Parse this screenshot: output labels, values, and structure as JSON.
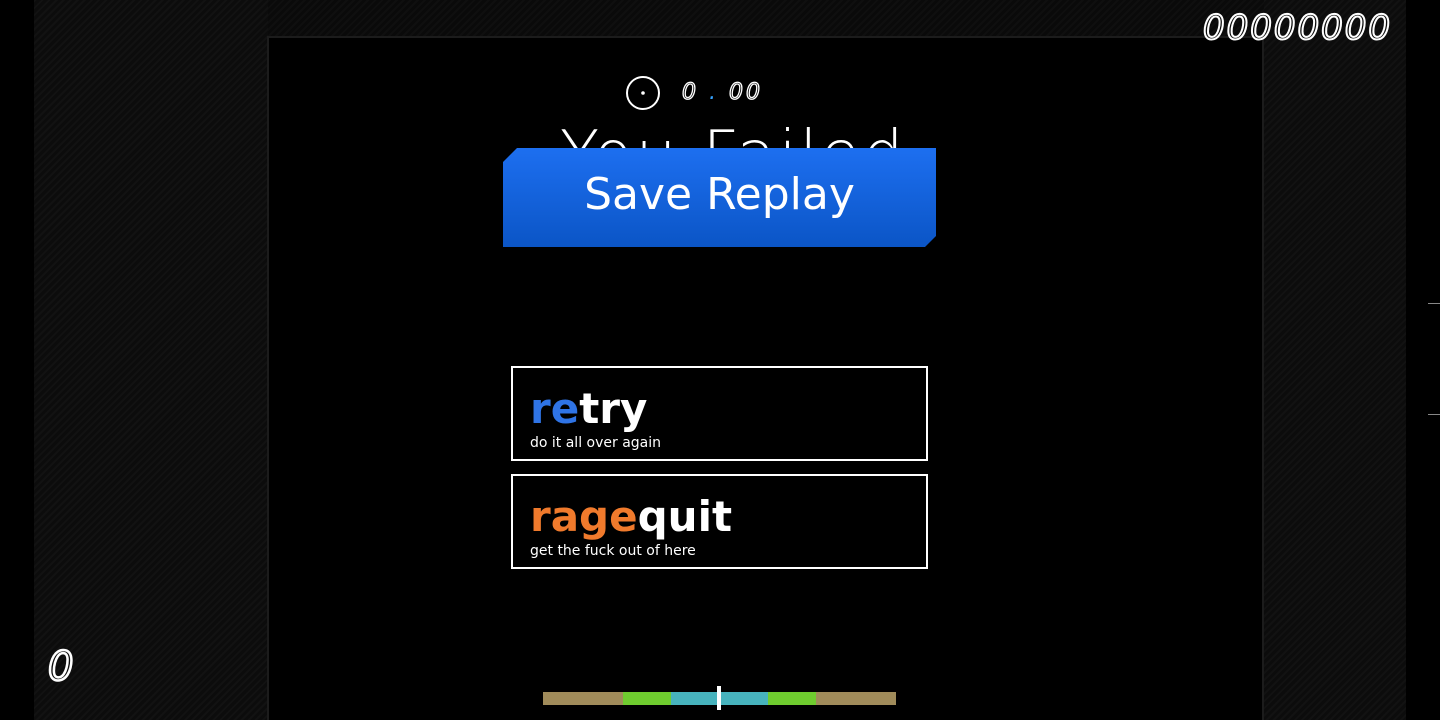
{
  "hud": {
    "score": "00000000",
    "combo": "0",
    "timer_int": "0",
    "timer_sep": ".",
    "timer_frac": "00"
  },
  "failed_title": "You Failed",
  "save_replay": {
    "label": "Save Replay"
  },
  "menu": {
    "retry": {
      "title_accent": "re",
      "title_rest": "try",
      "subtitle": "do it all over again"
    },
    "ragequit": {
      "title_accent": "rage",
      "title_rest": "quit",
      "subtitle": "get the fuck out of here"
    }
  },
  "colors": {
    "save_button": "#1d6ff0",
    "retry_accent": "#2f74e6",
    "ragequit_accent": "#f07a2c",
    "timer_dot": "#35a2ff",
    "hit_50": "#a08b5a",
    "hit_100": "#6fcc2f",
    "hit_300": "#47b3bd"
  },
  "icons": {
    "song_progress": "pie-timer-icon"
  }
}
